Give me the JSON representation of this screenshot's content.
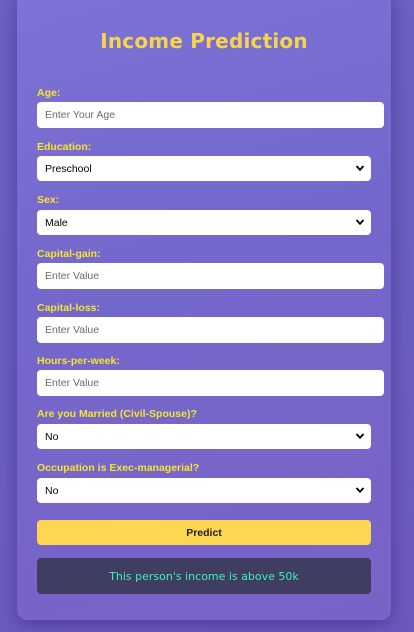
{
  "page": {
    "title": "Income Prediction"
  },
  "form": {
    "age": {
      "label": "Age:",
      "placeholder": "Enter Your Age",
      "value": ""
    },
    "education": {
      "label": "Education:",
      "selected": "Preschool"
    },
    "sex": {
      "label": "Sex:",
      "selected": "Male"
    },
    "capital_gain": {
      "label": "Capital-gain:",
      "placeholder": "Enter Value",
      "value": ""
    },
    "capital_loss": {
      "label": "Capital-loss:",
      "placeholder": "Enter Value",
      "value": ""
    },
    "hours_per_week": {
      "label": "Hours-per-week:",
      "placeholder": "Enter Value",
      "value": ""
    },
    "married": {
      "label": "Are you Married (Civil-Spouse)?",
      "selected": "No"
    },
    "exec_managerial": {
      "label": "Occupation is Exec-managerial?",
      "selected": "No"
    },
    "predict_label": "Predict"
  },
  "result": {
    "text": "This person's income is above 50k"
  },
  "colors": {
    "title": "#f7d54a",
    "label": "#f5e52e",
    "button": "#fdd751",
    "result_bg": "#3f3d62",
    "result_text": "#3ef2b0"
  },
  "icons": {
    "select_arrow": "chevron-down-icon"
  }
}
